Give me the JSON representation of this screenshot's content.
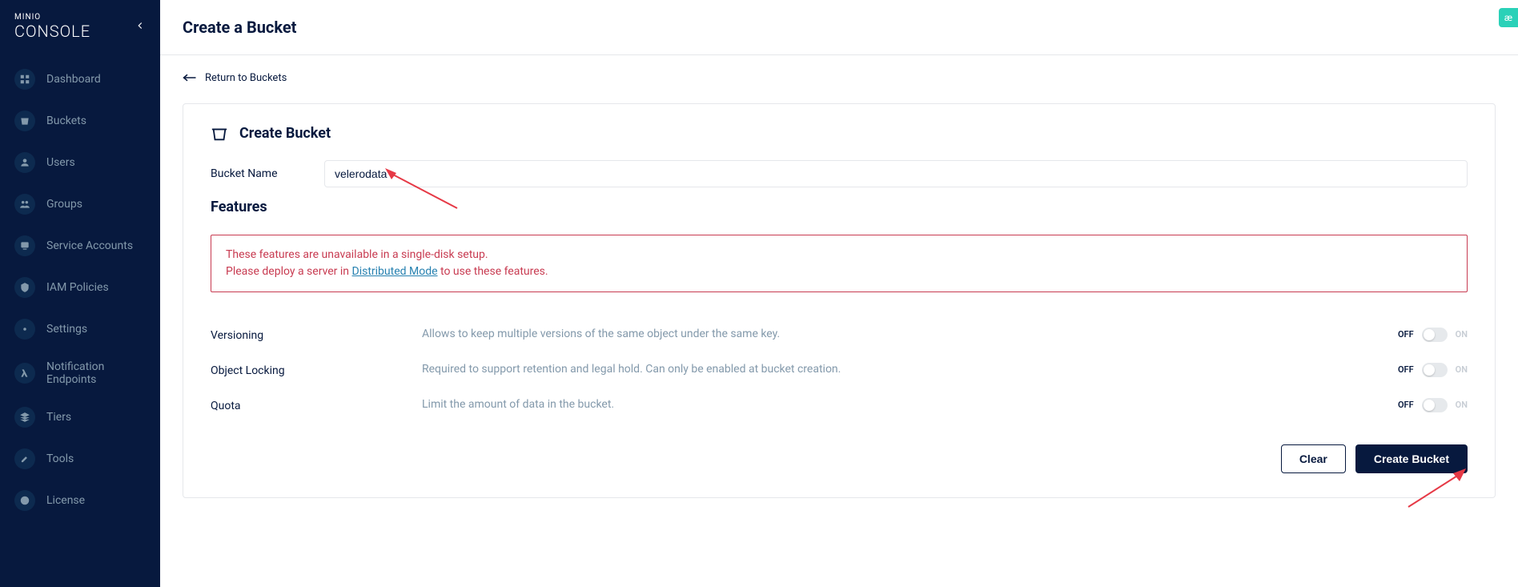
{
  "brand": {
    "top": "MINIO",
    "bottom": "CONSOLE"
  },
  "sidebar": {
    "items": [
      {
        "label": "Dashboard"
      },
      {
        "label": "Buckets"
      },
      {
        "label": "Users"
      },
      {
        "label": "Groups"
      },
      {
        "label": "Service Accounts"
      },
      {
        "label": "IAM Policies"
      },
      {
        "label": "Settings"
      },
      {
        "label": "Notification Endpoints"
      },
      {
        "label": "Tiers"
      },
      {
        "label": "Tools"
      },
      {
        "label": "License"
      }
    ]
  },
  "header": {
    "title": "Create a Bucket"
  },
  "back_link": "Return to Buckets",
  "form": {
    "title": "Create Bucket",
    "name_label": "Bucket Name",
    "name_value": "velerodata",
    "section_title": "Features"
  },
  "alert": {
    "line1": "These features are unavailable in a single-disk setup.",
    "line2_a": "Please deploy a server in ",
    "line2_link": "Distributed Mode",
    "line2_b": " to use these features."
  },
  "features": [
    {
      "label": "Versioning",
      "desc": "Allows to keep multiple versions of the same object under the same key."
    },
    {
      "label": "Object Locking",
      "desc": "Required to support retention and legal hold. Can only be enabled at bucket creation."
    },
    {
      "label": "Quota",
      "desc": "Limit the amount of data in the bucket."
    }
  ],
  "toggle": {
    "off": "OFF",
    "on": "ON"
  },
  "actions": {
    "clear": "Clear",
    "create": "Create Bucket"
  }
}
